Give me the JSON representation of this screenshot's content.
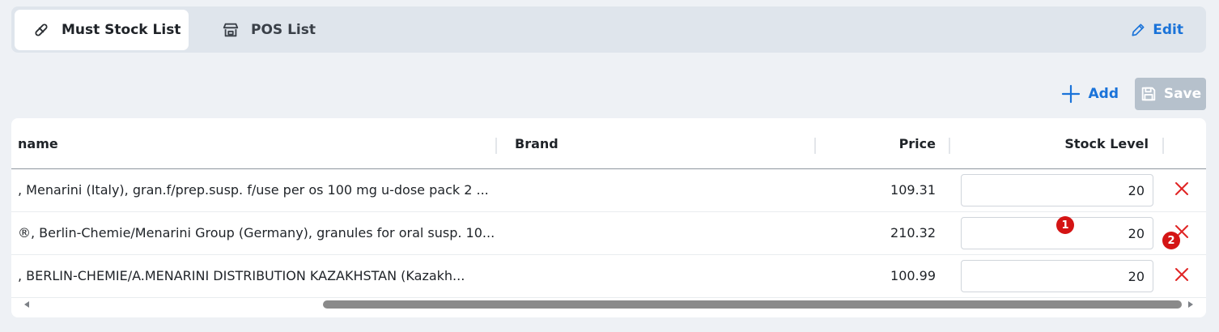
{
  "tabs": {
    "must_stock": {
      "label": "Must Stock List",
      "icon": "pill-icon"
    },
    "pos": {
      "label": "POS List",
      "icon": "store-icon"
    },
    "edit_label": "Edit"
  },
  "actions": {
    "add_label": "Add",
    "save_label": "Save"
  },
  "table": {
    "headers": {
      "name": "name",
      "brand": "Brand",
      "price": "Price",
      "stock_level": "Stock Level"
    },
    "rows": [
      {
        "name": ", Menarini (Italy), gran.f/prep.susp. f/use per os 100 mg u-dose pack 2 ...",
        "brand": "",
        "price": "109.31",
        "stock_level": "20"
      },
      {
        "name": "®, Berlin-Chemie/Menarini Group (Germany), granules for oral susp. 10...",
        "brand": "",
        "price": "210.32",
        "stock_level": "20"
      },
      {
        "name": ", BERLIN-CHEMIE/A.MENARINI DISTRIBUTION KAZAKHSTAN (Kazakh...",
        "brand": "",
        "price": "100.99",
        "stock_level": "20"
      }
    ]
  },
  "markers": [
    "1",
    "2"
  ],
  "colors": {
    "accent": "#1a73d9",
    "delete": "#e02424",
    "save_disabled": "#b6c1cc",
    "badge": "#d41414"
  }
}
